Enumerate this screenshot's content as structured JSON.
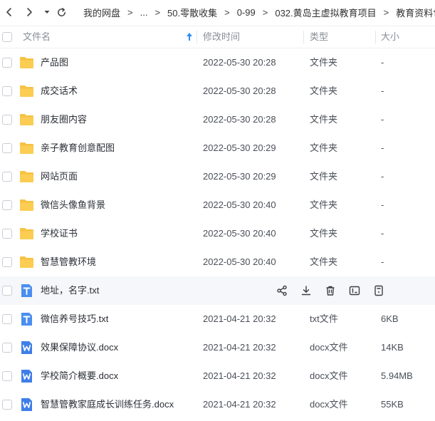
{
  "breadcrumb": {
    "items": [
      "我的网盘",
      "...",
      "50.零散收集",
      "0-99",
      "032.黄岛主虚拟教育项目",
      "教育资料包"
    ]
  },
  "header": {
    "name": "文件名",
    "modified": "修改时间",
    "type": "类型",
    "size": "大小"
  },
  "colors": {
    "folder": "#f7c242",
    "txt_icon": "#4a8ef0",
    "docx_icon": "#3f7ee8",
    "sort_arrow": "#2f8cf7",
    "hover_row": "#f5f7fa"
  },
  "files": [
    {
      "name": "产品图",
      "time": "2022-05-30 20:28",
      "type": "文件夹",
      "size": "-",
      "icon": "folder-icon"
    },
    {
      "name": "成交话术",
      "time": "2022-05-30 20:28",
      "type": "文件夹",
      "size": "-",
      "icon": "folder-icon"
    },
    {
      "name": "朋友圈内容",
      "time": "2022-05-30 20:28",
      "type": "文件夹",
      "size": "-",
      "icon": "folder-icon"
    },
    {
      "name": "亲子教育创意配图",
      "time": "2022-05-30 20:29",
      "type": "文件夹",
      "size": "-",
      "icon": "folder-icon"
    },
    {
      "name": "网站页面",
      "time": "2022-05-30 20:29",
      "type": "文件夹",
      "size": "-",
      "icon": "folder-icon"
    },
    {
      "name": "微信头像鱼背景",
      "time": "2022-05-30 20:40",
      "type": "文件夹",
      "size": "-",
      "icon": "folder-icon"
    },
    {
      "name": "学校证书",
      "time": "2022-05-30 20:40",
      "type": "文件夹",
      "size": "-",
      "icon": "folder-icon"
    },
    {
      "name": "智慧管教环境",
      "time": "2022-05-30 20:40",
      "type": "文件夹",
      "size": "-",
      "icon": "folder-icon"
    },
    {
      "name": "地址，名字.txt",
      "time": "",
      "type": "",
      "size": "",
      "icon": "txt-file-icon"
    },
    {
      "name": "微信养号技巧.txt",
      "time": "2021-04-21 20:32",
      "type": "txt文件",
      "size": "6KB",
      "icon": "txt-file-icon"
    },
    {
      "name": "效果保障协议.docx",
      "time": "2021-04-21 20:32",
      "type": "docx文件",
      "size": "14KB",
      "icon": "docx-file-icon"
    },
    {
      "name": "学校简介概要.docx",
      "time": "2021-04-21 20:32",
      "type": "docx文件",
      "size": "5.94MB",
      "icon": "docx-file-icon"
    },
    {
      "name": "智慧管教家庭成长训练任务.docx",
      "time": "2021-04-21 20:32",
      "type": "docx文件",
      "size": "55KB",
      "icon": "docx-file-icon"
    }
  ],
  "hover_actions": [
    "share-icon",
    "download-icon",
    "delete-icon",
    "rename-icon",
    "more-icon"
  ]
}
